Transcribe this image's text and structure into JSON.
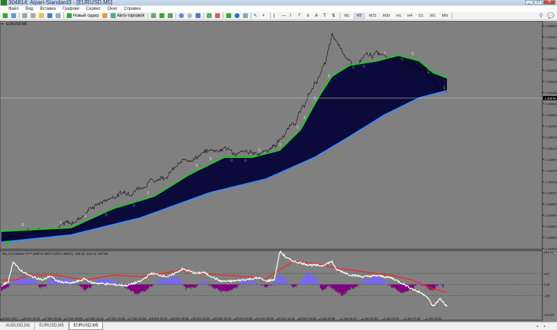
{
  "window": {
    "title": "304814: Alpari-Standard3 - [EURUSD,M5]",
    "minimize": "_",
    "maximize": "□",
    "close": "✕"
  },
  "menu": [
    "Файл",
    "Вид",
    "Вставка",
    "Графики",
    "Сервис",
    "Окно",
    "Справка"
  ],
  "toolbar": {
    "new_order": "Новый ордер",
    "auto_trading": "Авто-торговля",
    "timeframes": [
      "M1",
      "M5",
      "M15",
      "M30",
      "H1",
      "H4",
      "D1",
      "W1",
      "MN"
    ],
    "active_timeframe": "M5"
  },
  "chart": {
    "symbol_label": "EURUSD,M5",
    "current_price": "1.20078",
    "price_ticks": [
      "1.20880",
      "1.20760",
      "1.20635",
      "1.20510",
      "1.20385",
      "1.20260",
      "1.20135",
      "1.20015",
      "1.19890",
      "1.19765",
      "1.19640",
      "1.19515",
      "1.19390",
      "1.19270",
      "1.19145",
      "1.19025",
      "1.18905",
      "1.18780",
      "1.18655",
      "1.18530",
      "1.18410"
    ]
  },
  "indicator": {
    "label": "MS_CCI Waves TT™ (350^5->90^1^120^1=300^2) -105.18 -122.74 -207.08",
    "scale": [
      "294.74",
      "100",
      "0.00",
      "-100",
      "-274.57"
    ]
  },
  "time_labels": [
    "26 Dec 2017",
    "26 Dec 19:15",
    "27 Dec 00:35",
    "27 Dec 05:55",
    "27 Dec 11:15",
    "27 Dec 16:35",
    "27 Dec 21:55",
    "28 Dec 03:15",
    "28 Dec 08:35",
    "28 Dec 13:55",
    "28 Dec 19:15",
    "29 Dec 00:35",
    "29 Dec 05:55",
    "29 Dec 11:15",
    "29 Dec 16:35",
    "2 Jan 09:50",
    "2 Jan 15:10",
    "2 Jan 20:30",
    "3 Jan 01:50",
    "3 Jan 07:10",
    "3 Jan 12:30"
  ],
  "tabs": [
    {
      "label": "AUDUSD,M1",
      "active": false
    },
    {
      "label": "EURUSD,M5",
      "active": false
    },
    {
      "label": "EURUSD,M5",
      "active": true
    }
  ],
  "colors": {
    "bg": "#808080",
    "band_fill": "#0c0a3a",
    "upper": "#00e000",
    "lower": "#3a8cff",
    "price": "#000000",
    "cci": "#ffffff",
    "signal": "#ff2020",
    "hist_pos": "#7b68ee",
    "hist_neg": "#800080"
  },
  "chart_data": {
    "type": "line",
    "xlabel": "bar",
    "ylabel": "price",
    "price": [
      [
        0,
        1.1852
      ],
      [
        120,
        1.1864
      ],
      [
        200,
        1.1868
      ],
      [
        260,
        1.1887
      ],
      [
        320,
        1.1899
      ],
      [
        400,
        1.191
      ],
      [
        480,
        1.1925
      ],
      [
        540,
        1.1941
      ],
      [
        600,
        1.1949
      ],
      [
        640,
        1.1953
      ],
      [
        680,
        1.1945
      ],
      [
        760,
        1.1949
      ],
      [
        800,
        1.1961
      ],
      [
        860,
        1.1992
      ],
      [
        900,
        1.2023
      ],
      [
        930,
        1.2046
      ],
      [
        950,
        1.2074
      ],
      [
        980,
        1.2062
      ],
      [
        1010,
        1.2039
      ],
      [
        1040,
        1.2051
      ],
      [
        1100,
        1.2059
      ],
      [
        1160,
        1.2047
      ],
      [
        1200,
        1.2043
      ],
      [
        1240,
        1.2028
      ],
      [
        1270,
        1.2016
      ]
    ],
    "upper": [
      [
        0,
        1.186
      ],
      [
        200,
        1.1864
      ],
      [
        320,
        1.1885
      ],
      [
        440,
        1.1899
      ],
      [
        540,
        1.1923
      ],
      [
        640,
        1.1942
      ],
      [
        720,
        1.1942
      ],
      [
        800,
        1.195
      ],
      [
        860,
        1.1973
      ],
      [
        910,
        1.2008
      ],
      [
        950,
        1.2032
      ],
      [
        1000,
        1.2044
      ],
      [
        1080,
        1.2049
      ],
      [
        1140,
        1.2055
      ],
      [
        1200,
        1.2049
      ],
      [
        1240,
        1.2036
      ],
      [
        1280,
        1.203
      ]
    ],
    "lower": [
      [
        0,
        1.1848
      ],
      [
        200,
        1.1856
      ],
      [
        400,
        1.1875
      ],
      [
        600,
        1.1903
      ],
      [
        760,
        1.1918
      ],
      [
        900,
        1.1942
      ],
      [
        1000,
        1.1965
      ],
      [
        1100,
        1.1989
      ],
      [
        1200,
        1.2008
      ],
      [
        1280,
        1.2016
      ]
    ],
    "cci": [
      [
        0,
        -20
      ],
      [
        20,
        30
      ],
      [
        34,
        210
      ],
      [
        50,
        140
      ],
      [
        80,
        80
      ],
      [
        120,
        40
      ],
      [
        140,
        80
      ],
      [
        160,
        30
      ],
      [
        200,
        10
      ],
      [
        240,
        50
      ],
      [
        260,
        15
      ],
      [
        360,
        -10
      ],
      [
        400,
        30
      ],
      [
        430,
        100
      ],
      [
        480,
        70
      ],
      [
        520,
        140
      ],
      [
        560,
        100
      ],
      [
        580,
        110
      ],
      [
        630,
        30
      ],
      [
        660,
        30
      ],
      [
        690,
        40
      ],
      [
        740,
        60
      ],
      [
        760,
        30
      ],
      [
        784,
        45
      ],
      [
        800,
        300
      ],
      [
        820,
        240
      ],
      [
        840,
        210
      ],
      [
        880,
        180
      ],
      [
        920,
        170
      ],
      [
        950,
        210
      ],
      [
        960,
        140
      ],
      [
        1000,
        90
      ],
      [
        1040,
        70
      ],
      [
        1080,
        80
      ],
      [
        1120,
        60
      ],
      [
        1140,
        30
      ],
      [
        1180,
        -40
      ],
      [
        1220,
        -100
      ],
      [
        1240,
        -200
      ],
      [
        1260,
        -130
      ],
      [
        1280,
        -200
      ]
    ],
    "signal": [
      [
        0,
        40
      ],
      [
        40,
        40
      ],
      [
        80,
        85
      ],
      [
        160,
        85
      ],
      [
        240,
        40
      ],
      [
        320,
        85
      ],
      [
        400,
        70
      ],
      [
        480,
        110
      ],
      [
        520,
        130
      ],
      [
        560,
        100
      ],
      [
        640,
        85
      ],
      [
        720,
        65
      ],
      [
        760,
        50
      ],
      [
        800,
        135
      ],
      [
        840,
        210
      ],
      [
        900,
        190
      ],
      [
        960,
        150
      ],
      [
        1040,
        115
      ],
      [
        1120,
        85
      ],
      [
        1180,
        40
      ],
      [
        1240,
        -40
      ],
      [
        1280,
        -70
      ]
    ],
    "histogram": [
      [
        0,
        -60
      ],
      [
        20,
        -20
      ],
      [
        30,
        20
      ],
      [
        60,
        60
      ],
      [
        100,
        40
      ],
      [
        110,
        -30
      ],
      [
        130,
        -10
      ],
      [
        140,
        50
      ],
      [
        200,
        50
      ],
      [
        220,
        -5
      ],
      [
        240,
        -50
      ],
      [
        260,
        -20
      ],
      [
        280,
        50
      ],
      [
        320,
        40
      ],
      [
        360,
        -30
      ],
      [
        390,
        -90
      ],
      [
        420,
        -40
      ],
      [
        450,
        30
      ],
      [
        510,
        70
      ],
      [
        530,
        -40
      ],
      [
        560,
        -20
      ],
      [
        580,
        40
      ],
      [
        600,
        -10
      ],
      [
        630,
        -60
      ],
      [
        660,
        -60
      ],
      [
        680,
        -10
      ],
      [
        690,
        40
      ],
      [
        720,
        30
      ],
      [
        760,
        -20
      ],
      [
        780,
        10
      ],
      [
        800,
        100
      ],
      [
        820,
        30
      ],
      [
        830,
        -10
      ],
      [
        840,
        -30
      ],
      [
        860,
        30
      ],
      [
        880,
        120
      ],
      [
        910,
        40
      ],
      [
        920,
        -60
      ],
      [
        940,
        -10
      ],
      [
        980,
        -100
      ],
      [
        1000,
        -40
      ],
      [
        1020,
        -20
      ],
      [
        1040,
        30
      ],
      [
        1080,
        80
      ],
      [
        1100,
        40
      ],
      [
        1120,
        -20
      ],
      [
        1150,
        -80
      ],
      [
        1180,
        -40
      ],
      [
        1200,
        30
      ],
      [
        1210,
        -10
      ],
      [
        1240,
        -50
      ],
      [
        1260,
        20
      ],
      [
        1270,
        -20
      ]
    ],
    "ylim_price": [
      1.1841,
      1.2088
    ],
    "ylim_cci": [
      -274.57,
      294.74
    ],
    "levels": [
      100,
      0,
      -100
    ]
  }
}
